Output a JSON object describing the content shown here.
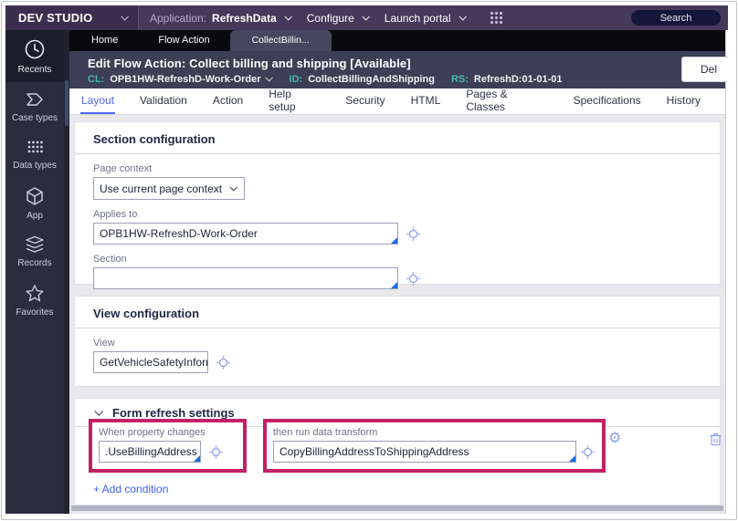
{
  "topbar": {
    "brand": "DEV STUDIO",
    "application_label": "Application:",
    "application_name": "RefreshData",
    "configure_label": "Configure",
    "launch_portal_label": "Launch portal",
    "search_label": "Search"
  },
  "sidebar": {
    "items": [
      {
        "label": "Recents"
      },
      {
        "label": "Case types"
      },
      {
        "label": "Data types"
      },
      {
        "label": "App"
      },
      {
        "label": "Records"
      },
      {
        "label": "Favorites"
      }
    ]
  },
  "doc_tabs": {
    "home": "Home",
    "flow_action": "Flow Action",
    "active": "CollectBillin..."
  },
  "edit_header": {
    "title": "Edit  Flow Action: Collect billing and shipping [Available]",
    "cl_label": "CL:",
    "cl_value": "OPB1HW-RefreshD-Work-Order",
    "id_label": "ID:",
    "id_value": "CollectBillingAndShipping",
    "rs_label": "RS:",
    "rs_value": "RefreshD:01-01-01",
    "delete_label": "Del"
  },
  "rule_tabs": [
    "Layout",
    "Validation",
    "Action",
    "Help setup",
    "Security",
    "HTML",
    "Pages & Classes",
    "Specifications",
    "History"
  ],
  "section_config": {
    "title": "Section configuration",
    "page_context_label": "Page context",
    "page_context_value": "Use current page context",
    "applies_to_label": "Applies to",
    "applies_to_value": "OPB1HW-RefreshD-Work-Order",
    "section_label": "Section",
    "section_value": ""
  },
  "view_config": {
    "title": "View configuration",
    "view_label": "View",
    "view_value": "GetVehicleSafetyInform"
  },
  "form_refresh": {
    "title": "Form refresh settings",
    "when_label": "When property changes",
    "when_value": ".UseBillingAddress",
    "then_label": "then run data transform",
    "then_value": "CopyBillingAddressToShippingAddress",
    "add_condition_label": "+ Add condition"
  },
  "colors": {
    "highlight_magenta": "#c42067",
    "accent_blue": "#4c66f0",
    "teal": "#45b9ab"
  }
}
